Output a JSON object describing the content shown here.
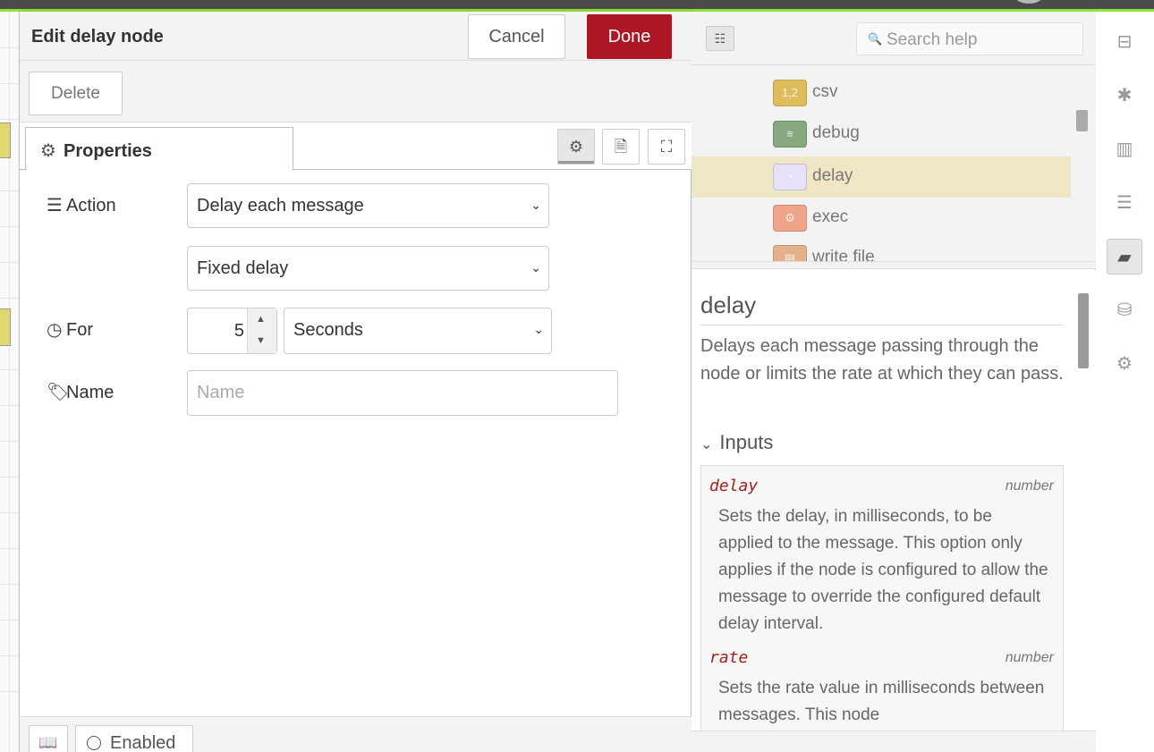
{
  "tray": {
    "title": "Edit delay node",
    "cancel_label": "Cancel",
    "done_label": "Done",
    "delete_label": "Delete",
    "tab_label": "Properties"
  },
  "form": {
    "action_label": "Action",
    "action_value": "Delay each message",
    "delay_type_value": "Fixed delay",
    "for_label": "For",
    "for_value": "5",
    "units_value": "Seconds",
    "name_label": "Name",
    "name_value": "",
    "name_placeholder": "Name"
  },
  "footer": {
    "enabled_label": "Enabled"
  },
  "sidebar": {
    "search_placeholder": "Search help",
    "palette": [
      {
        "label": "csv",
        "color": "#DEBD5C",
        "glyph": "1,2"
      },
      {
        "label": "debug",
        "color": "#87A980",
        "glyph": "≡"
      },
      {
        "label": "delay",
        "color": "#E6E0F8",
        "glyph": "◔"
      },
      {
        "label": "exec",
        "color": "#FDD0A2",
        "glyph": "⚙"
      },
      {
        "label": "write file",
        "color": "#E7E7AE",
        "glyph": "▤"
      }
    ],
    "help": {
      "title": "delay",
      "description": "Delays each message passing through the node or limits the rate at which they can pass.",
      "inputs_heading": "Inputs",
      "props": [
        {
          "name": "delay",
          "type": "number",
          "desc": "Sets the delay, in milliseconds, to be applied to the message. This option only applies if the node is configured to allow the message to override the configured default delay interval."
        },
        {
          "name": "rate",
          "type": "number",
          "desc": "Sets the rate value in milliseconds between messages. This node"
        }
      ]
    }
  },
  "colors": {
    "done": "#AD1625",
    "accent_bar": "#8EE03C",
    "selected_row": "#EFE6C6"
  },
  "icons": {
    "rail": [
      "flows-icon",
      "debug-bug-icon",
      "chart-icon",
      "tree-icon",
      "book-icon",
      "database-icon",
      "gear-icon"
    ]
  }
}
